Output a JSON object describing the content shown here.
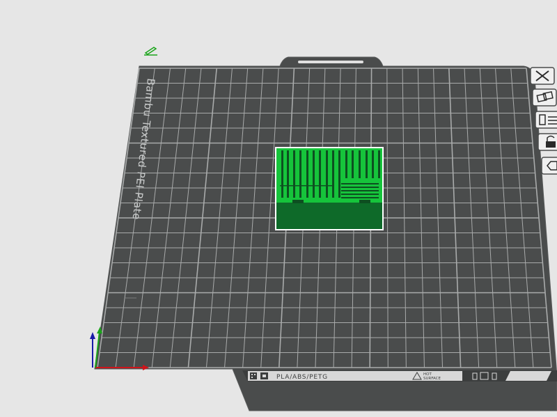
{
  "viewport": {
    "background": "#e6e6e6",
    "plate_name": "Bambu Textured PEI Plate",
    "plate_color": "#4a4c4c",
    "grid_color": "#a9abab",
    "model_color": "#16c43b"
  },
  "plate_footer": {
    "filament_types": "PLA/ABS/PETG",
    "warning_line1": "HOT",
    "warning_line2": "SURFACE"
  },
  "side_toolbar": {
    "items": [
      {
        "name": "close-plate-icon"
      },
      {
        "name": "arrange-plate-icon"
      },
      {
        "name": "plate-settings-icon"
      },
      {
        "name": "lock-plate-icon"
      },
      {
        "name": "plate-options-icon"
      }
    ]
  },
  "axes": {
    "x_color": "#d0141a",
    "y_color": "#1aa41a",
    "z_color": "#1a1aa8"
  },
  "edit_icon": "pencil-edit-icon"
}
